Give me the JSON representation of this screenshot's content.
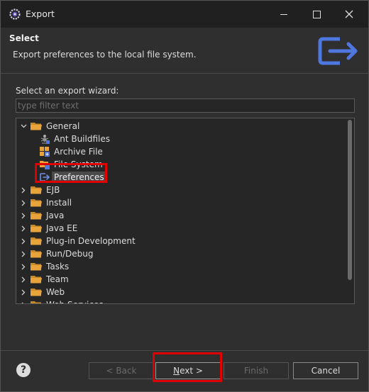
{
  "window": {
    "title": "Export",
    "icon": "eclipse-gear-icon"
  },
  "header": {
    "title": "Select",
    "description": "Export preferences to the local file system.",
    "icon": "export-arrow-icon",
    "accent_color": "#4e78e0"
  },
  "wizard": {
    "label": "Select an export wizard:",
    "filter_placeholder": "type filter text",
    "filter_value": ""
  },
  "tree": {
    "items": [
      {
        "label": "General",
        "expanded": true,
        "level": 0,
        "type": "folder"
      },
      {
        "label": "Ant Buildfiles",
        "level": 1,
        "type": "ant"
      },
      {
        "label": "Archive File",
        "level": 1,
        "type": "archive"
      },
      {
        "label": "File System",
        "level": 1,
        "type": "filesystem"
      },
      {
        "label": "Preferences",
        "level": 1,
        "type": "preferences",
        "selected": true
      },
      {
        "label": "EJB",
        "expanded": false,
        "level": 0,
        "type": "folder"
      },
      {
        "label": "Install",
        "expanded": false,
        "level": 0,
        "type": "folder"
      },
      {
        "label": "Java",
        "expanded": false,
        "level": 0,
        "type": "folder"
      },
      {
        "label": "Java EE",
        "expanded": false,
        "level": 0,
        "type": "folder"
      },
      {
        "label": "Plug-in Development",
        "expanded": false,
        "level": 0,
        "type": "folder"
      },
      {
        "label": "Run/Debug",
        "expanded": false,
        "level": 0,
        "type": "folder"
      },
      {
        "label": "Tasks",
        "expanded": false,
        "level": 0,
        "type": "folder"
      },
      {
        "label": "Team",
        "expanded": false,
        "level": 0,
        "type": "folder"
      },
      {
        "label": "Web",
        "expanded": false,
        "level": 0,
        "type": "folder"
      },
      {
        "label": "Web Services",
        "expanded": false,
        "level": 0,
        "type": "folder"
      }
    ]
  },
  "footer": {
    "help_label": "?",
    "back_label": "< Back",
    "next_label_mnemonic": "N",
    "next_label_rest": "ext >",
    "finish_label": "Finish",
    "cancel_label": "Cancel"
  },
  "colors": {
    "highlight": "#e00000",
    "folder": "#e8a33a"
  }
}
